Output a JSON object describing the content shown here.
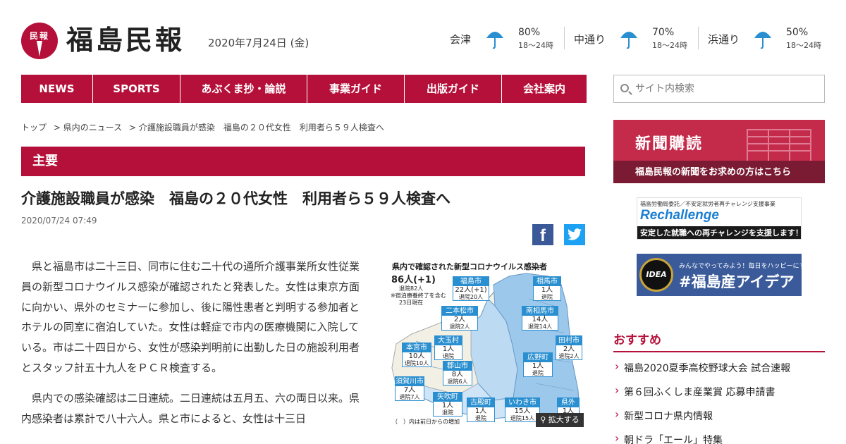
{
  "logo": {
    "mark_text": "民報",
    "name": "福島民報"
  },
  "date": "2020年7月24日 (金)",
  "weather": [
    {
      "area": "会津",
      "pct": "80%",
      "hours": "18～24時",
      "icon": "umbrella-icon"
    },
    {
      "area": "中通り",
      "pct": "70%",
      "hours": "18～24時",
      "icon": "umbrella-icon"
    },
    {
      "area": "浜通り",
      "pct": "50%",
      "hours": "18～24時",
      "icon": "umbrella-icon"
    }
  ],
  "nav": [
    "NEWS",
    "SPORTS",
    "あぶくま抄・論説",
    "事業ガイド",
    "出版ガイド",
    "会社案内"
  ],
  "search": {
    "placeholder": "サイト内検索"
  },
  "breadcrumb": [
    "トップ",
    "> 県内のニュース",
    "> 介護施設職員が感染　福島の２０代女性　利用者ら５９人検査へ"
  ],
  "section_title": "主要",
  "article": {
    "headline": "介護施設職員が感染　福島の２０代女性　利用者ら５９人検査へ",
    "published": "2020/07/24 07:49",
    "paragraphs": [
      "県と福島市は二十三日、同市に住む二十代の通所介護事業所女性従業員の新型コロナウイルス感染が確認されたと発表した。女性は東京方面に向かい、県外のセミナーに参加し、後に陽性患者と判明する参加者とホテルの同室に宿泊していた。女性は軽症で市内の医療機関に入院している。市は二十四日から、女性が感染判明前に出勤した日の施設利用者とスタッフ計五十九人をＰＣＲ検査する。",
      "県内での感染確認は二日連続。二日連続は五月五、六の両日以来。県内感染者は累計で八十六人。県と市によると、女性は十三日"
    ]
  },
  "figure": {
    "title": "県内で確認された新型コロナウイルス感染者",
    "total": "86人(+1)",
    "discharged": "退院82人",
    "note1": "※宿泊療養終了を含む",
    "note2": "23日現在",
    "footnote": "（　）内は前日からの増加",
    "zoom_label": "拡大する",
    "regions": [
      {
        "name": "福島市",
        "count": "22人(+1)",
        "sub": "退院20人"
      },
      {
        "name": "相馬市",
        "count": "1人",
        "sub": "退院"
      },
      {
        "name": "二本松市",
        "count": "2人",
        "sub": "退院2人"
      },
      {
        "name": "南相馬市",
        "count": "14人",
        "sub": "退院14人"
      },
      {
        "name": "大玉村",
        "count": "1人",
        "sub": "退院"
      },
      {
        "name": "田村市",
        "count": "2人",
        "sub": "退院2人"
      },
      {
        "name": "本宮市",
        "count": "10人",
        "sub": "退院10人"
      },
      {
        "name": "郡山市",
        "count": "8人",
        "sub": "退院6人"
      },
      {
        "name": "広野町",
        "count": "1人",
        "sub": "退院"
      },
      {
        "name": "須賀川市",
        "count": "7人",
        "sub": "退院7人"
      },
      {
        "name": "矢吹町",
        "count": "1人",
        "sub": "退院"
      },
      {
        "name": "古殿町",
        "count": "1人",
        "sub": "退院"
      },
      {
        "name": "いわき市",
        "count": "15人",
        "sub": "退院15人"
      },
      {
        "name": "県外",
        "count": "1人",
        "sub": "退院"
      }
    ]
  },
  "sidebar": {
    "subscribe_title": "新聞購読",
    "subscribe_sub": "福島民報の新聞をお求めの方はこちら",
    "banner1": {
      "top": "福島労働局委託／不安定就労者再チャレンジ支援事業",
      "big": "Rechallenge",
      "low": "安定した就職への再チャレンジを支援します！"
    },
    "banner2": {
      "badge": "IDEA",
      "top": "みんなでやってみよう！毎日をハッピーにする",
      "big": "#福島産アイデア"
    },
    "recommend_title": "おすすめ",
    "recommend": [
      "福島2020夏季高校野球大会 試合速報",
      "第６回ふくしま産業賞 応募申請書",
      "新型コロナ県内情報",
      "朝ドラ「エール」特集"
    ]
  }
}
